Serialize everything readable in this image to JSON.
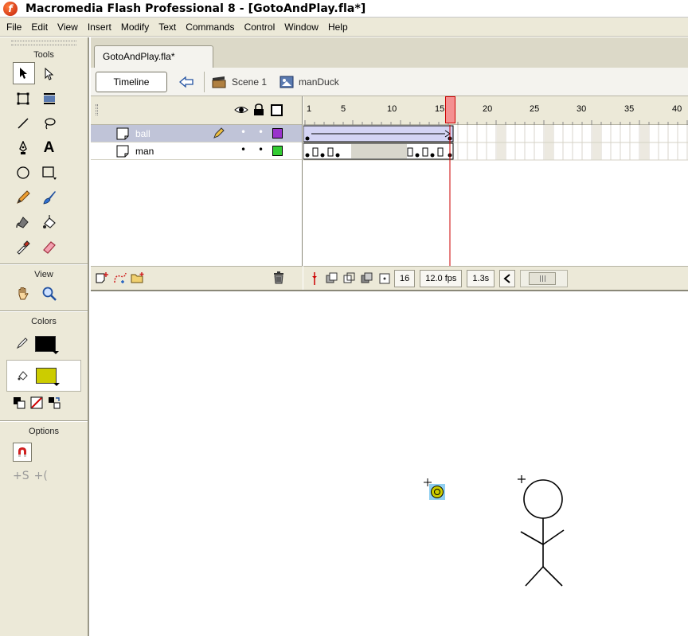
{
  "window": {
    "title": "Macromedia Flash Professional 8 - [GotoAndPlay.fla*]"
  },
  "menu": [
    "File",
    "Edit",
    "View",
    "Insert",
    "Modify",
    "Text",
    "Commands",
    "Control",
    "Window",
    "Help"
  ],
  "toolbox": {
    "tools_label": "Tools",
    "view_label": "View",
    "colors_label": "Colors",
    "options_label": "Options",
    "stroke_color": "#000000",
    "fill_color": "#cccc00"
  },
  "document": {
    "tab": "GotoAndPlay.fla*",
    "timeline_button": "Timeline",
    "breadcrumbs": [
      "Scene 1",
      "manDuck"
    ]
  },
  "timeline": {
    "ruler": [
      "1",
      "5",
      "10",
      "15",
      "20",
      "25",
      "30",
      "35",
      "40"
    ],
    "current_frame": "16",
    "fps": "12.0 fps",
    "elapsed": "1.3s",
    "layers": [
      {
        "name": "ball",
        "color": "#9933cc",
        "selected": true
      },
      {
        "name": "man",
        "color": "#33cc33",
        "selected": false
      }
    ]
  },
  "colors": {
    "accent": "#cc0000",
    "selection": "#c0c4d8"
  }
}
